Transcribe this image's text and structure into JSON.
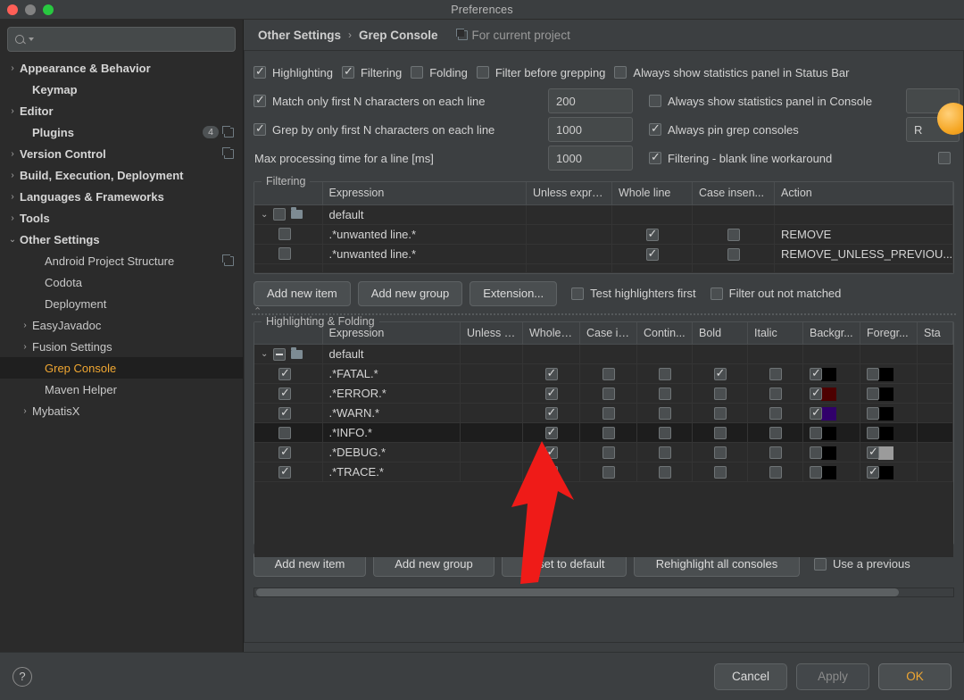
{
  "window": {
    "title": "Preferences"
  },
  "traffic": {
    "close": "close-button",
    "minimize": "minimize-button",
    "zoom": "zoom-button"
  },
  "sidebar": {
    "search": {
      "value": "",
      "placeholder": ""
    },
    "items": [
      {
        "label": "Appearance & Behavior",
        "arrow": "›",
        "bold": true,
        "indent": 0,
        "badge": "",
        "copy": false,
        "selected": false
      },
      {
        "label": "Keymap",
        "arrow": "",
        "bold": true,
        "indent": 1,
        "badge": "",
        "copy": false,
        "selected": false
      },
      {
        "label": "Editor",
        "arrow": "›",
        "bold": true,
        "indent": 0,
        "badge": "",
        "copy": false,
        "selected": false
      },
      {
        "label": "Plugins",
        "arrow": "",
        "bold": true,
        "indent": 1,
        "badge": "4",
        "copy": true,
        "selected": false
      },
      {
        "label": "Version Control",
        "arrow": "›",
        "bold": true,
        "indent": 0,
        "badge": "",
        "copy": true,
        "selected": false
      },
      {
        "label": "Build, Execution, Deployment",
        "arrow": "›",
        "bold": true,
        "indent": 0,
        "badge": "",
        "copy": false,
        "selected": false
      },
      {
        "label": "Languages & Frameworks",
        "arrow": "›",
        "bold": true,
        "indent": 0,
        "badge": "",
        "copy": false,
        "selected": false
      },
      {
        "label": "Tools",
        "arrow": "›",
        "bold": true,
        "indent": 0,
        "badge": "",
        "copy": false,
        "selected": false
      },
      {
        "label": "Other Settings",
        "arrow": "⌄",
        "bold": true,
        "indent": 0,
        "badge": "",
        "copy": false,
        "selected": false
      },
      {
        "label": "Android Project Structure",
        "arrow": "",
        "bold": false,
        "indent": 2,
        "badge": "",
        "copy": true,
        "selected": false
      },
      {
        "label": "Codota",
        "arrow": "",
        "bold": false,
        "indent": 2,
        "badge": "",
        "copy": false,
        "selected": false
      },
      {
        "label": "Deployment",
        "arrow": "",
        "bold": false,
        "indent": 2,
        "badge": "",
        "copy": false,
        "selected": false
      },
      {
        "label": "EasyJavadoc",
        "arrow": "›",
        "bold": false,
        "indent": 1,
        "badge": "",
        "copy": false,
        "selected": false
      },
      {
        "label": "Fusion Settings",
        "arrow": "›",
        "bold": false,
        "indent": 1,
        "badge": "",
        "copy": false,
        "selected": false
      },
      {
        "label": "Grep Console",
        "arrow": "",
        "bold": false,
        "indent": 2,
        "badge": "",
        "copy": false,
        "selected": true
      },
      {
        "label": "Maven Helper",
        "arrow": "",
        "bold": false,
        "indent": 2,
        "badge": "",
        "copy": false,
        "selected": false
      },
      {
        "label": "MybatisX",
        "arrow": "›",
        "bold": false,
        "indent": 1,
        "badge": "",
        "copy": false,
        "selected": false
      }
    ]
  },
  "breadcrumb": {
    "parent": "Other Settings",
    "separator": "›",
    "current": "Grep Console",
    "project_scope": "For current project"
  },
  "options": {
    "row1": [
      {
        "label": "Highlighting",
        "checked": true
      },
      {
        "label": "Filtering",
        "checked": true
      },
      {
        "label": "Folding",
        "checked": false
      },
      {
        "label": "Filter before grepping",
        "checked": false
      },
      {
        "label": "Always show statistics panel in Status Bar",
        "checked": false
      }
    ],
    "row2": {
      "label": "Match only first N characters on each line",
      "checked": true,
      "value": "200",
      "right": {
        "label": "Always show statistics panel in Console",
        "checked": false
      }
    },
    "row3": {
      "label": "Grep by only first N characters on each line",
      "checked": true,
      "value": "1000",
      "right": {
        "label": "Always pin grep consoles",
        "checked": true
      }
    },
    "row4": {
      "label": "Max processing time for a line [ms]",
      "value": "1000",
      "right": {
        "label": "Filtering - blank line workaround",
        "checked": true
      }
    },
    "right_field_1": "",
    "right_field_2": "R",
    "right_checkbox": false
  },
  "filtering": {
    "title": "Filtering",
    "columns": [
      "",
      "Expression",
      "Unless expre...",
      "Whole line",
      "Case insen...",
      "Action"
    ],
    "rows": [
      {
        "type": "group",
        "checked": false,
        "expression": "default",
        "unless": "",
        "whole_line": null,
        "case_insensitive": null,
        "action": ""
      },
      {
        "type": "item",
        "checked": false,
        "expression": ".*unwanted line.*",
        "unless": "",
        "whole_line": true,
        "case_insensitive": false,
        "action": "REMOVE"
      },
      {
        "type": "item",
        "checked": false,
        "expression": ".*unwanted line.*",
        "unless": "",
        "whole_line": true,
        "case_insensitive": false,
        "action": "REMOVE_UNLESS_PREVIOU..."
      }
    ],
    "buttons": [
      "Add new item",
      "Add new group",
      "Extension..."
    ],
    "checkboxes": [
      {
        "label": "Test highlighters first",
        "checked": false
      },
      {
        "label": "Filter out not matched",
        "checked": false
      }
    ]
  },
  "highlighting": {
    "title": "Highlighting & Folding",
    "columns": [
      "",
      "Expression",
      "Unless e...",
      "Whole l...",
      "Case in...",
      "Contin...",
      "Bold",
      "Italic",
      "Backgr...",
      "Foregr...",
      "Sta"
    ],
    "rows": [
      {
        "type": "group",
        "checked": "minus",
        "expression": "default",
        "unless": "",
        "whole_line": null,
        "case_insensitive": null,
        "continue": null,
        "bold": null,
        "italic": null,
        "background": null,
        "bg_color": "",
        "foreground": null,
        "fg_color": ""
      },
      {
        "type": "item",
        "checked": true,
        "expression": ".*FATAL.*",
        "unless": "",
        "whole_line": true,
        "case_insensitive": false,
        "continue": false,
        "bold": true,
        "italic": false,
        "background": true,
        "bg_color": "#000000",
        "foreground": false,
        "fg_color": "#000000"
      },
      {
        "type": "item",
        "checked": true,
        "expression": ".*ERROR.*",
        "unless": "",
        "whole_line": true,
        "case_insensitive": false,
        "continue": false,
        "bold": false,
        "italic": false,
        "background": true,
        "bg_color": "#4d0000",
        "foreground": false,
        "fg_color": "#000000"
      },
      {
        "type": "item",
        "checked": true,
        "expression": ".*WARN.*",
        "unless": "",
        "whole_line": true,
        "case_insensitive": false,
        "continue": false,
        "bold": false,
        "italic": false,
        "background": true,
        "bg_color": "#31006b",
        "foreground": false,
        "fg_color": "#000000"
      },
      {
        "type": "item",
        "checked": false,
        "expression": ".*INFO.*",
        "selected": true,
        "unless": "",
        "whole_line": true,
        "case_insensitive": false,
        "continue": false,
        "bold": false,
        "italic": false,
        "background": false,
        "bg_color": "#000000",
        "foreground": false,
        "fg_color": "#000000"
      },
      {
        "type": "item",
        "checked": true,
        "expression": ".*DEBUG.*",
        "unless": "",
        "whole_line": true,
        "case_insensitive": false,
        "continue": false,
        "bold": false,
        "italic": false,
        "background": false,
        "bg_color": "#000000",
        "foreground": true,
        "fg_color": "#9b9b9b"
      },
      {
        "type": "item",
        "checked": true,
        "expression": ".*TRACE.*",
        "unless": "",
        "whole_line": true,
        "case_insensitive": false,
        "continue": false,
        "bold": false,
        "italic": false,
        "background": false,
        "bg_color": "#000000",
        "foreground": true,
        "fg_color": "#000000"
      }
    ],
    "buttons": [
      "Add new item",
      "Add new group",
      "Reset to default",
      "Rehighlight all consoles"
    ],
    "checkbox": {
      "label": "Use a previous",
      "checked": false
    }
  },
  "footer": {
    "help": "?",
    "cancel": "Cancel",
    "apply": "Apply",
    "ok": "OK"
  },
  "colors": {
    "accent": "#f0a732",
    "panel_bg": "#3c3f41",
    "table_bg": "#2b2b2b",
    "sidebar_bg": "#2b2b2b"
  }
}
